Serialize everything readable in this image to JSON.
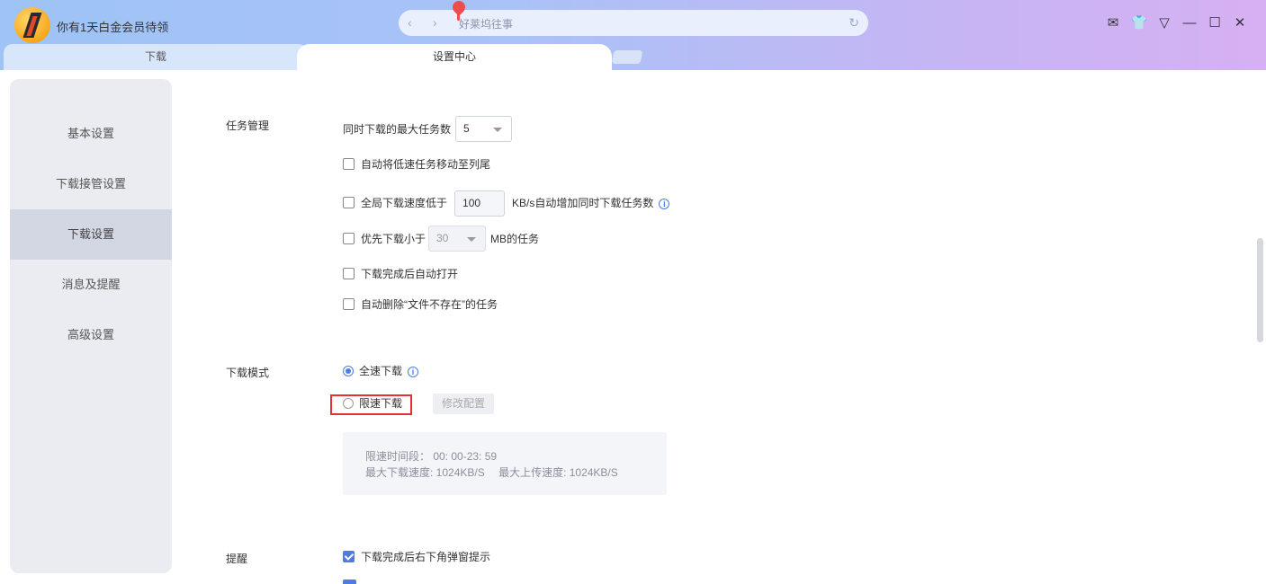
{
  "header": {
    "promo_text": "你有1天白金会员待领",
    "address_text": "好莱坞往事",
    "back_glyph": "‹",
    "forward_glyph": "›",
    "refresh_glyph": "↻"
  },
  "window_controls": {
    "mail_icon": "✉",
    "skin_icon": "👕",
    "menu_icon": "▽",
    "minimize_icon": "—",
    "maximize_icon": "☐",
    "close_icon": "✕"
  },
  "tabs": [
    {
      "label": "下载"
    },
    {
      "label": "设置中心"
    }
  ],
  "sidebar": {
    "items": [
      {
        "label": "基本设置"
      },
      {
        "label": "下载接管设置"
      },
      {
        "label": "下载设置"
      },
      {
        "label": "消息及提醒"
      },
      {
        "label": "高级设置"
      }
    ],
    "active_index": 2
  },
  "task_management": {
    "title": "任务管理",
    "max_tasks_label": "同时下载的最大任务数",
    "max_tasks_value": "5",
    "move_slow_label": "自动将低速任务移动至列尾",
    "speed_prefix": "全局下载速度低于",
    "speed_value": "100",
    "speed_suffix": "KB/s自动增加同时下载任务数",
    "priority_prefix": "优先下载小于",
    "priority_value": "30",
    "priority_suffix": "MB的任务",
    "auto_open_label": "下载完成后自动打开",
    "auto_delete_label": "自动删除“文件不存在”的任务"
  },
  "download_mode": {
    "title": "下载模式",
    "full_speed_label": "全速下载",
    "limited_label": "限速下载",
    "modify_button": "修改配置",
    "limit_period": "限速时间段： 00: 00-23: 59",
    "max_download": "最大下载速度: 1024KB/S",
    "max_upload": "最大上传速度: 1024KB/S"
  },
  "reminder": {
    "title": "提醒",
    "popup_label": "下载完成后右下角弹窗提示"
  },
  "colors": {
    "accent": "#4a7fe0",
    "highlight": "#e03333"
  }
}
